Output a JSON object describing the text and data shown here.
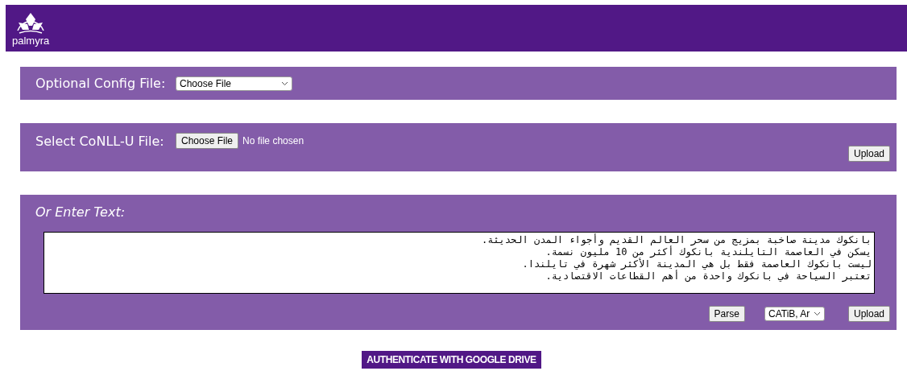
{
  "header": {
    "logo_text": "palmyra"
  },
  "config_panel": {
    "label": "Optional Config File:",
    "select_value": "Choose File"
  },
  "conll_panel": {
    "label": "Select CoNLL-U File:",
    "file_button": "Choose File",
    "file_status": "No file chosen",
    "upload_button": "Upload"
  },
  "text_panel": {
    "label": "Or Enter Text:",
    "text_lines": [
      "بانكوك مدينة صاخبة بمزيج من سحر العالم القديم وأجواء المدن الحديثة.",
      "يسكن في العاصمة التايلندية بانكوك أكثر من 10 مليون نسمة.",
      "ليست بانكوك العاصمة فقط بل هي المدينة الأكثر شهرة في تايلندا.",
      "تعتبر السياحة في بانكوك واحدة من أهم القطاعات الاقتصادية."
    ],
    "parse_button": "Parse",
    "format_select": "CATiB, Ar",
    "upload_button": "Upload"
  },
  "auth_button": "AUTHENTICATE WITH GOOGLE DRIVE"
}
